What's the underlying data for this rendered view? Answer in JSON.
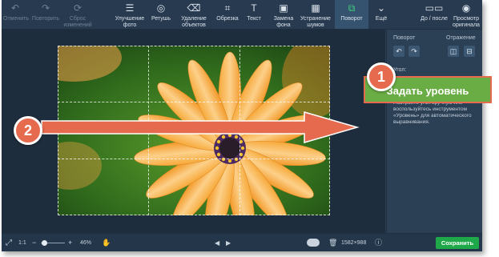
{
  "toolbar": {
    "items": [
      {
        "label": "Отменить",
        "icon": "undo-icon",
        "glyph": "↶",
        "state": "disabled"
      },
      {
        "label": "Повторить",
        "icon": "redo-icon",
        "glyph": "↷",
        "state": "disabled"
      },
      {
        "label": "Сброс изменений",
        "icon": "reset-icon",
        "glyph": "⟳",
        "state": "disabled"
      },
      {
        "label": "Улучшение фото",
        "icon": "sliders-icon",
        "glyph": "☰",
        "state": "normal"
      },
      {
        "label": "Ретушь",
        "icon": "retouch-icon",
        "glyph": "◎",
        "state": "normal"
      },
      {
        "label": "Удаление объектов",
        "icon": "eraser-icon",
        "glyph": "⌫",
        "state": "normal"
      },
      {
        "label": "Обрезка",
        "icon": "crop-icon",
        "glyph": "⌗",
        "state": "normal"
      },
      {
        "label": "Текст",
        "icon": "text-icon",
        "glyph": "T",
        "state": "normal"
      },
      {
        "label": "Замена фона",
        "icon": "background-icon",
        "glyph": "▣",
        "state": "normal"
      },
      {
        "label": "Устранение шумов",
        "icon": "noise-icon",
        "glyph": "▦",
        "state": "normal"
      },
      {
        "label": "Поворот",
        "icon": "rotate-icon",
        "glyph": "⧉",
        "state": "active"
      },
      {
        "label": "Ещё",
        "icon": "chevron-down-icon",
        "glyph": "⌄",
        "state": "normal"
      },
      {
        "label": "До / после",
        "icon": "before-after-icon",
        "glyph": "▭▭",
        "state": "normal"
      },
      {
        "label": "Просмотр оригинала",
        "icon": "eye-icon",
        "glyph": "◉",
        "state": "normal"
      }
    ]
  },
  "panel": {
    "rotation_label": "Поворот",
    "mirror_label": "Отражение",
    "angle_label": "Угол:",
    "description": "Настройте угол вручную или воспользуйтесь инструментом «Уровень» для автоматического выравнивания.",
    "rotate_left_glyph": "↶",
    "rotate_right_glyph": "↷",
    "flip_h_glyph": "◫",
    "flip_v_glyph": "⊟"
  },
  "bottombar": {
    "fit_glyph": "⤢",
    "ratio": "1:1",
    "zoom_out_glyph": "−",
    "zoom_in_glyph": "+",
    "zoom": "46%",
    "hand_glyph": "✋",
    "prev_glyph": "◀",
    "next_glyph": "▶",
    "dimensions": "1582×988",
    "info_glyph": "ⓘ",
    "save_label": "Сохранить"
  },
  "callouts": {
    "badge1": "1",
    "badge2": "2",
    "big_button_label": "Задать уровень"
  },
  "colors": {
    "accent_green": "#1ea84a",
    "callout_orange": "#e66a4e",
    "level_button_green": "#6aad45"
  }
}
